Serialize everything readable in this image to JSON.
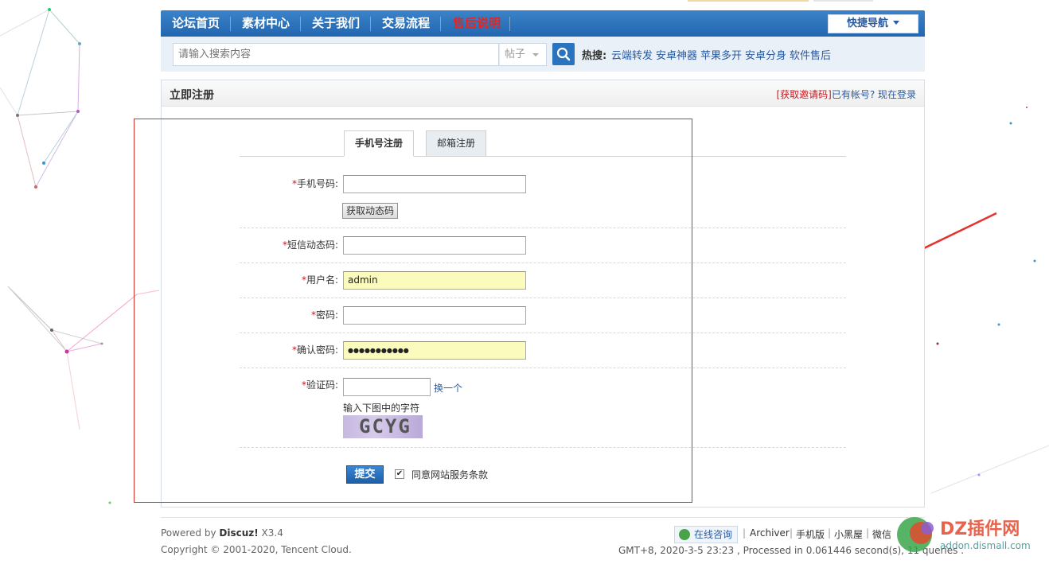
{
  "nav": {
    "items": [
      "论坛首页",
      "素材中心",
      "关于我们",
      "交易流程",
      "售后说明"
    ],
    "quick_nav": "快捷导航"
  },
  "search": {
    "placeholder": "请输入搜索内容",
    "type": "帖子",
    "hot_label": "热搜:",
    "hot_links": [
      "云端转发",
      "安卓神器",
      "苹果多开",
      "安卓分身",
      "软件售后"
    ]
  },
  "panel": {
    "title": "立即注册",
    "invite_link": "[获取邀请码]",
    "login_prompt": "已有帐号? 现在登录"
  },
  "tabs": [
    "手机号注册",
    "邮箱注册"
  ],
  "form": {
    "phone_label": "手机号码:",
    "get_code_button": "获取动态码",
    "sms_label": "短信动态码:",
    "username_label": "用户名:",
    "username_value": "admin",
    "password_label": "密码:",
    "confirm_label": "确认密码:",
    "confirm_value": "●●●●●●●●●●●",
    "captcha_label": "验证码:",
    "captcha_refresh": "换一个",
    "captcha_hint": "输入下图中的字符",
    "captcha_text": "GCYG",
    "required_mark": "*",
    "submit_button": "提交",
    "agree_label": "同意网站服务条款",
    "agree_checked": "✔"
  },
  "footer": {
    "powered_prefix": "Powered by ",
    "powered_brand": "Discuz!",
    "powered_version": " X3.4",
    "copyright": "Copyright © 2001-2020, Tencent Cloud.",
    "consult": "在线咨询",
    "links": [
      "Archiver",
      "手机版",
      "小黑屋",
      "微信"
    ],
    "gmt": "GMT+8, 2020-3-5 23:23 , Processed in 0.061446 second(s), 11 queries ."
  },
  "watermark": {
    "brand": "DZ插件网",
    "url": "addon.dismall.com"
  },
  "colors": {
    "nav_blue": "#2a6cb8",
    "hot_red": "#e8241e",
    "highlight_red": "#d9302b",
    "input_yellow": "#fbfbbd"
  }
}
